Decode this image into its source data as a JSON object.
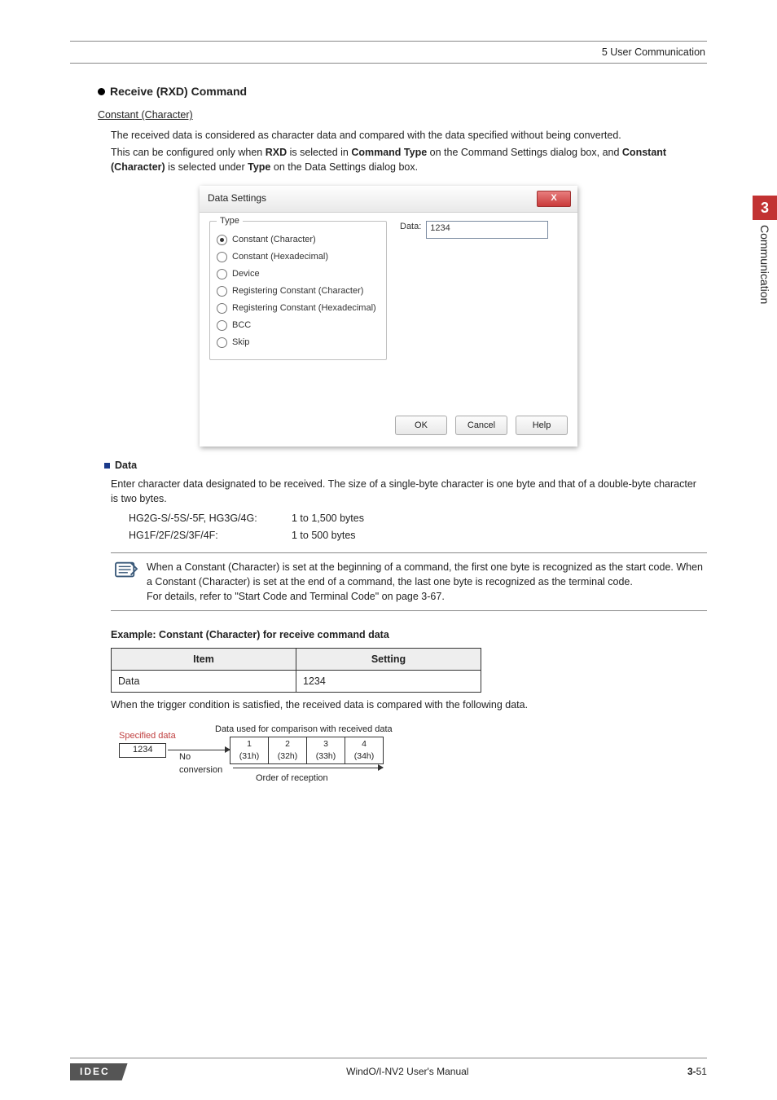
{
  "header": {
    "section": "5 User Communication"
  },
  "section": {
    "title": "Receive (RXD) Command",
    "subtitle": "Constant (Character)",
    "para1": "The received data is considered as character data and compared with the data specified without being converted.",
    "para2_pre": "This can be configured only when ",
    "para2_b1": "RXD",
    "para2_mid": " is selected in ",
    "para2_b2": "Command Type",
    "para2_aft": " on the Command Settings dialog box, and ",
    "para2_b3": "Constant (Character)",
    "para2_mid2": " is selected under ",
    "para2_b4": "Type",
    "para2_end": " on the Data Settings dialog box."
  },
  "dialog": {
    "title": "Data Settings",
    "close": "X",
    "legend": "Type",
    "options": [
      "Constant (Character)",
      "Constant (Hexadecimal)",
      "Device",
      "Registering Constant (Character)",
      "Registering Constant (Hexadecimal)",
      "BCC",
      "Skip"
    ],
    "selected_index": 0,
    "data_label": "Data:",
    "data_value": "1234",
    "buttons": {
      "ok": "OK",
      "cancel": "Cancel",
      "help": "Help"
    }
  },
  "data_section": {
    "heading": "Data",
    "desc": "Enter character data designated to be received. The size of a single-byte character is one byte and that of a double-byte character is two bytes.",
    "rows": [
      {
        "k": "HG2G-S/-5S/-5F, HG3G/4G:",
        "v": "1 to 1,500 bytes"
      },
      {
        "k": "HG1F/2F/2S/3F/4F:",
        "v": "1 to 500 bytes"
      }
    ]
  },
  "note": {
    "line1": "When a Constant (Character) is set at the beginning of a command, the first one byte is recognized as the start code. When a Constant (Character) is set at the end of a command, the last one byte is recognized as the terminal code.",
    "line2": "For details, refer to \"Start Code and Terminal Code\" on page 3-67."
  },
  "example": {
    "title": "Example: Constant (Character) for receive command data",
    "th1": "Item",
    "th2": "Setting",
    "td1": "Data",
    "td2": "1234",
    "after": "When the trigger condition is satisfied, the received data is compared with the following data."
  },
  "diagram": {
    "top_label": "Data used for comparison with received data",
    "spec_label": "Specified data",
    "spec_value": "1234",
    "no_conv_1": "No",
    "no_conv_2": "conversion",
    "order": "Order of reception",
    "bytes": [
      {
        "c": "1",
        "h": "(31h)"
      },
      {
        "c": "2",
        "h": "(32h)"
      },
      {
        "c": "3",
        "h": "(33h)"
      },
      {
        "c": "4",
        "h": "(34h)"
      }
    ]
  },
  "side_tab": {
    "num": "3",
    "label": "Communication"
  },
  "footer": {
    "brand": "IDEC",
    "manual": "WindO/I-NV2 User's Manual",
    "chap": "3-",
    "page": "51"
  }
}
